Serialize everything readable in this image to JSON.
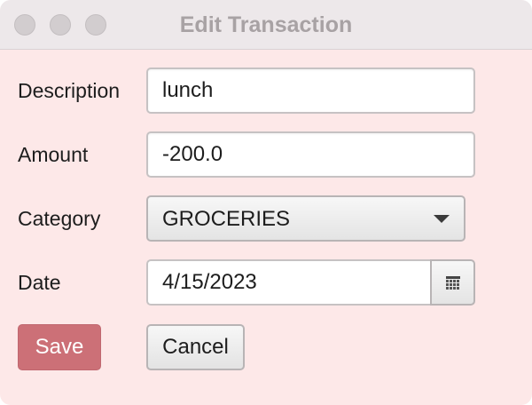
{
  "window": {
    "title": "Edit Transaction"
  },
  "form": {
    "description": {
      "label": "Description",
      "value": "lunch"
    },
    "amount": {
      "label": "Amount",
      "value": "-200.0"
    },
    "category": {
      "label": "Category",
      "selected": "GROCERIES"
    },
    "date": {
      "label": "Date",
      "value": "4/15/2023",
      "picker_icon": "calendar-icon"
    }
  },
  "actions": {
    "save_label": "Save",
    "cancel_label": "Cancel"
  },
  "colors": {
    "background": "#fde8e8",
    "titlebar": "#ede8ea",
    "save_button": "#cc7077"
  }
}
